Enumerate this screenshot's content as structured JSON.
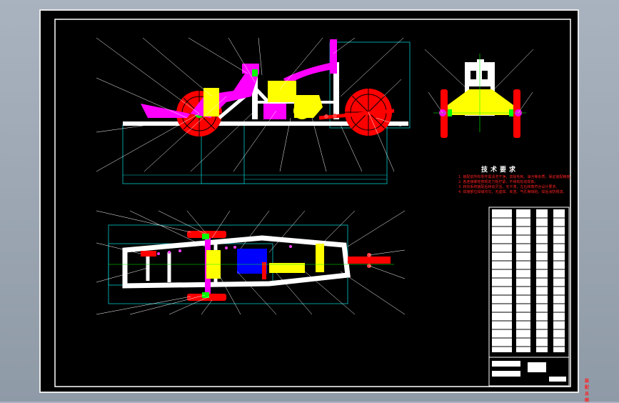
{
  "drawing": {
    "title": "",
    "notes_heading": "技术要求",
    "notes": [
      "1. 装配前所有零件需清洗干净，去除毛刺、油污等杂质，保证装配精度。",
      "2. 各连接螺栓按规定力矩拧紧，不得有松动现象。",
      "3. 转向系统装配后转动灵活，无卡滞，左右转角符合设计要求。",
      "4. 焊接部位焊缝均匀，无虚焊、夹渣、气孔等缺陷，焊后涂防锈漆。"
    ],
    "title_block_label": "装配总图",
    "colors": {
      "background": "#000000",
      "border": "#ffffff",
      "dimension": "#00c8c8",
      "frame": "#ffffff",
      "wheel": "#ff0000",
      "linkage": "#ff00ff",
      "engine": "#ffff00",
      "leader": "#ffffff",
      "notes": "#ff2020"
    },
    "views": [
      "side-view",
      "end-view",
      "top-view",
      "title-block"
    ]
  }
}
